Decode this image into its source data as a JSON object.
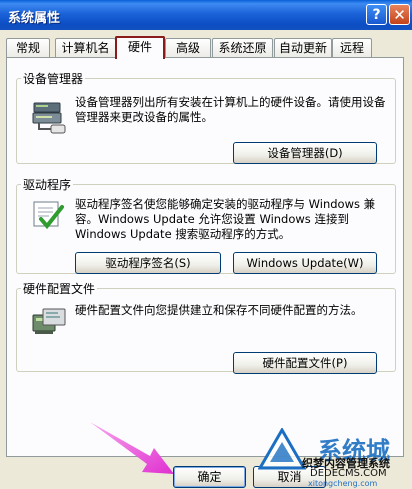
{
  "window": {
    "title": "系统属性",
    "help_label": "?",
    "close_label": "✕"
  },
  "tabs": [
    {
      "label": "常规"
    },
    {
      "label": "计算机名"
    },
    {
      "label": "硬件"
    },
    {
      "label": "高级"
    },
    {
      "label": "系统还原"
    },
    {
      "label": "自动更新"
    },
    {
      "label": "远程"
    }
  ],
  "active_tab": "硬件",
  "device_manager": {
    "legend": "设备管理器",
    "text": "设备管理器列出所有安装在计算机上的硬件设备。请使用设备管理器来更改设备的属性。",
    "button": "设备管理器(D)"
  },
  "drivers": {
    "legend": "驱动程序",
    "text": "驱动程序签名使您能够确定安装的驱动程序与 Windows 兼容。Windows Update 允许您设置 Windows 连接到 Windows Update 搜索驱动程序的方式。",
    "signing_button": "驱动程序签名(S)",
    "update_button": "Windows Update(W)"
  },
  "hardware_profiles": {
    "legend": "硬件配置文件",
    "text": "硬件配置文件向您提供建立和保存不同硬件配置的方法。",
    "button": "硬件配置文件(P)"
  },
  "footer": {
    "ok": "确定",
    "cancel": "取消"
  },
  "watermark": {
    "brand": "系统城",
    "line1": "织梦内容管理系统",
    "line2": "DEDECMS.COM",
    "url": "xitongcheng.com"
  },
  "colors": {
    "titlebar": "#0D4EC4",
    "active_tab_highlight": "#8B1A1A",
    "arrow": "#E838D6",
    "watermark": "#1B6FC2"
  }
}
